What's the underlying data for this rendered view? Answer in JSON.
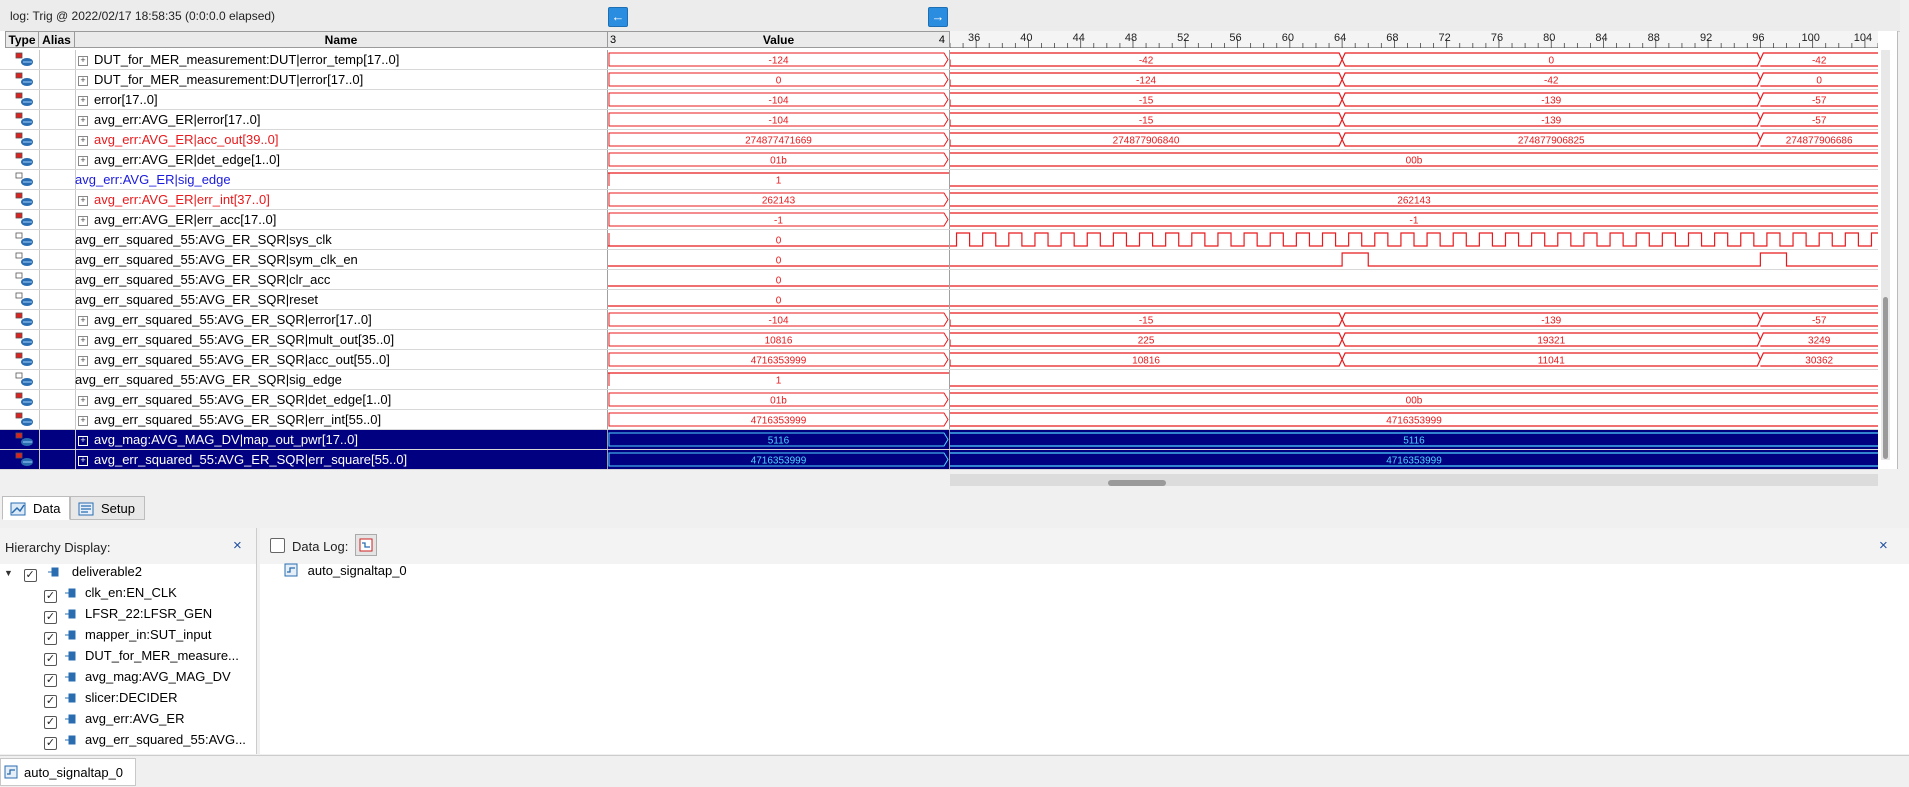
{
  "log_title": "log: Trig @ 2022/02/17 18:58:35 (0:0:0.0 elapsed)",
  "colors": {
    "wave": "#e8191c",
    "blue_text": "#1a1adc",
    "red_text": "#e8191c",
    "selected_bg": "#000080",
    "selected_text": "#4fd3ff",
    "nav_button": "#2a8de0"
  },
  "headers": {
    "type": "Type",
    "alias": "Alias",
    "name": "Name",
    "value": "Value",
    "value_left_tick": "3",
    "value_right_tick": "4"
  },
  "timeline": {
    "start": 34,
    "end": 105,
    "ticks": [
      36,
      40,
      44,
      48,
      52,
      56,
      60,
      64,
      68,
      72,
      76,
      80,
      84,
      88,
      92,
      96,
      100,
      104
    ]
  },
  "signals": [
    {
      "name": "DUT_for_MER_measurement:DUT|error_temp[17..0]",
      "expand": true,
      "color": "black",
      "kind": "bus",
      "value": "-124",
      "segments": [
        {
          "from": 34,
          "to": 64,
          "label": "-42"
        },
        {
          "from": 64,
          "to": 96,
          "label": "0"
        },
        {
          "from": 96,
          "to": 105,
          "label": "-42"
        }
      ]
    },
    {
      "name": "DUT_for_MER_measurement:DUT|error[17..0]",
      "expand": true,
      "color": "black",
      "kind": "bus",
      "value": "0",
      "segments": [
        {
          "from": 34,
          "to": 64,
          "label": "-124"
        },
        {
          "from": 64,
          "to": 96,
          "label": "-42"
        },
        {
          "from": 96,
          "to": 105,
          "label": "0"
        }
      ]
    },
    {
      "name": "error[17..0]",
      "expand": true,
      "color": "black",
      "kind": "bus",
      "value": "-104",
      "segments": [
        {
          "from": 34,
          "to": 64,
          "label": "-15"
        },
        {
          "from": 64,
          "to": 96,
          "label": "-139"
        },
        {
          "from": 96,
          "to": 105,
          "label": "-57"
        }
      ]
    },
    {
      "name": "avg_err:AVG_ER|error[17..0]",
      "expand": true,
      "color": "black",
      "kind": "bus",
      "value": "-104",
      "segments": [
        {
          "from": 34,
          "to": 64,
          "label": "-15"
        },
        {
          "from": 64,
          "to": 96,
          "label": "-139"
        },
        {
          "from": 96,
          "to": 105,
          "label": "-57"
        }
      ]
    },
    {
      "name": "avg_err:AVG_ER|acc_out[39..0]",
      "expand": true,
      "color": "red",
      "kind": "bus",
      "value": "274877471669",
      "segments": [
        {
          "from": 34,
          "to": 64,
          "label": "274877906840"
        },
        {
          "from": 64,
          "to": 96,
          "label": "274877906825"
        },
        {
          "from": 96,
          "to": 105,
          "label": "274877906686"
        }
      ]
    },
    {
      "name": "avg_err:AVG_ER|det_edge[1..0]",
      "expand": true,
      "color": "black",
      "kind": "bus",
      "value": "01b",
      "segments": [
        {
          "from": 34,
          "to": 105,
          "label": "00b"
        }
      ]
    },
    {
      "name": "avg_err:AVG_ER|sig_edge",
      "expand": false,
      "color": "blue",
      "kind": "bit",
      "value": "1",
      "level": "low"
    },
    {
      "name": "avg_err:AVG_ER|err_int[37..0]",
      "expand": true,
      "color": "red",
      "kind": "bus",
      "value": "262143",
      "segments": [
        {
          "from": 34,
          "to": 105,
          "label": "262143"
        }
      ]
    },
    {
      "name": "avg_err:AVG_ER|err_acc[17..0]",
      "expand": true,
      "color": "black",
      "kind": "bus",
      "value": "-1",
      "segments": [
        {
          "from": 34,
          "to": 105,
          "label": "-1"
        }
      ]
    },
    {
      "name": "avg_err_squared_55:AVG_ER_SQR|sys_clk",
      "expand": false,
      "color": "black",
      "kind": "clock",
      "value": "0"
    },
    {
      "name": "avg_err_squared_55:AVG_ER_SQR|sym_clk_en",
      "expand": false,
      "color": "black",
      "kind": "pulses",
      "value": "0",
      "pulses": [
        64,
        96
      ]
    },
    {
      "name": "avg_err_squared_55:AVG_ER_SQR|clr_acc",
      "expand": false,
      "color": "black",
      "kind": "bit",
      "value": "0",
      "level": "low"
    },
    {
      "name": "avg_err_squared_55:AVG_ER_SQR|reset",
      "expand": false,
      "color": "black",
      "kind": "bit",
      "value": "0",
      "level": "low"
    },
    {
      "name": "avg_err_squared_55:AVG_ER_SQR|error[17..0]",
      "expand": true,
      "color": "black",
      "kind": "bus",
      "value": "-104",
      "segments": [
        {
          "from": 34,
          "to": 64,
          "label": "-15"
        },
        {
          "from": 64,
          "to": 96,
          "label": "-139"
        },
        {
          "from": 96,
          "to": 105,
          "label": "-57"
        }
      ]
    },
    {
      "name": "avg_err_squared_55:AVG_ER_SQR|mult_out[35..0]",
      "expand": true,
      "color": "black",
      "kind": "bus",
      "value": "10816",
      "segments": [
        {
          "from": 34,
          "to": 64,
          "label": "225"
        },
        {
          "from": 64,
          "to": 96,
          "label": "19321"
        },
        {
          "from": 96,
          "to": 105,
          "label": "3249"
        }
      ]
    },
    {
      "name": "avg_err_squared_55:AVG_ER_SQR|acc_out[55..0]",
      "expand": true,
      "color": "black",
      "kind": "bus",
      "value": "4716353999",
      "segments": [
        {
          "from": 34,
          "to": 64,
          "label": "10816"
        },
        {
          "from": 64,
          "to": 96,
          "label": "11041"
        },
        {
          "from": 96,
          "to": 105,
          "label": "30362"
        }
      ]
    },
    {
      "name": "avg_err_squared_55:AVG_ER_SQR|sig_edge",
      "expand": false,
      "color": "black",
      "kind": "bit",
      "value": "1",
      "level": "low"
    },
    {
      "name": "avg_err_squared_55:AVG_ER_SQR|det_edge[1..0]",
      "expand": true,
      "color": "black",
      "kind": "bus",
      "value": "01b",
      "segments": [
        {
          "from": 34,
          "to": 105,
          "label": "00b"
        }
      ]
    },
    {
      "name": "avg_err_squared_55:AVG_ER_SQR|err_int[55..0]",
      "expand": true,
      "color": "black",
      "kind": "bus",
      "value": "4716353999",
      "segments": [
        {
          "from": 34,
          "to": 105,
          "label": "4716353999"
        }
      ]
    },
    {
      "name": "avg_mag:AVG_MAG_DV|map_out_pwr[17..0]",
      "expand": true,
      "color": "white",
      "selected": true,
      "kind": "bus",
      "value": "5116",
      "segments": [
        {
          "from": 34,
          "to": 105,
          "label": "5116"
        }
      ]
    },
    {
      "name": "avg_err_squared_55:AVG_ER_SQR|err_square[55..0]",
      "expand": true,
      "color": "white",
      "selected": true,
      "kind": "bus",
      "value": "4716353999",
      "segments": [
        {
          "from": 34,
          "to": 105,
          "label": "4716353999"
        }
      ]
    }
  ],
  "tabs": {
    "data": "Data",
    "setup": "Setup"
  },
  "hierarchy": {
    "title": "Hierarchy Display:",
    "close": "×",
    "root": "deliverable2",
    "items": [
      "clk_en:EN_CLK",
      "LFSR_22:LFSR_GEN",
      "mapper_in:SUT_input",
      "DUT_for_MER_measure...",
      "avg_mag:AVG_MAG_DV",
      "slicer:DECIDER",
      "avg_err:AVG_ER",
      "avg_err_squared_55:AVG..."
    ]
  },
  "data_log": {
    "title": "Data Log:",
    "close": "×",
    "entry": "auto_signaltap_0"
  },
  "status_tab": "auto_signaltap_0"
}
